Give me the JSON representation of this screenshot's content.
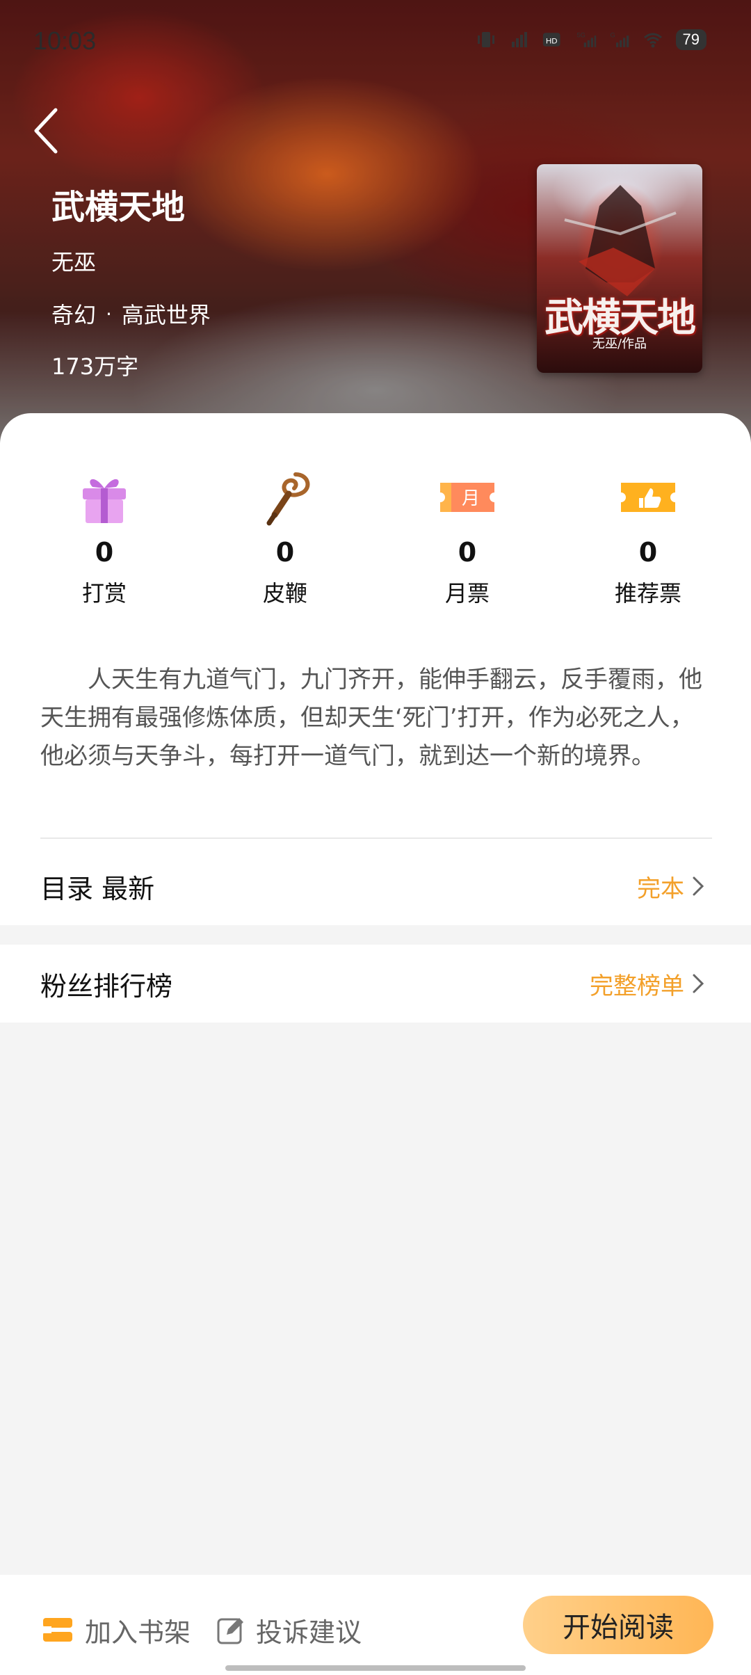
{
  "status_bar": {
    "time": "10:03",
    "battery": "79",
    "icons": [
      "vibrate-icon",
      "signal-hd-icon",
      "hd-icon",
      "5g-signal-icon",
      "g-signal-icon",
      "wifi-icon"
    ]
  },
  "book": {
    "title": "武横天地",
    "author": "无巫",
    "genre_main": "奇幻",
    "genre_sub": "高武世界",
    "genre_separator": "·",
    "word_count": "173万字",
    "cover_title": "武横天地",
    "cover_subtitle": "无巫/作品"
  },
  "stats": [
    {
      "icon": "gift-icon",
      "value": "0",
      "label": "打赏"
    },
    {
      "icon": "whip-icon",
      "value": "0",
      "label": "皮鞭"
    },
    {
      "icon": "monthly-ticket-icon",
      "value": "0",
      "label": "月票",
      "icon_text": "月"
    },
    {
      "icon": "recommend-ticket-icon",
      "value": "0",
      "label": "推荐票"
    }
  ],
  "synopsis": "人天生有九道气门，九门齐开，能伸手翻云，反手覆雨，他天生拥有最强修炼体质，但却天生‘死门’打开，作为必死之人，他必须与天争斗，每打开一道气门，就到达一个新的境界。",
  "catalog": {
    "label": "目录 最新",
    "status": "完本"
  },
  "fans": {
    "label": "粉丝排行榜",
    "link": "完整榜单"
  },
  "bottom": {
    "add_shelf": "加入书架",
    "feedback": "投诉建议",
    "start_reading": "开始阅读"
  },
  "colors": {
    "accent": "#f3a02a",
    "button_gradient_start": "#ffd08a",
    "button_gradient_end": "#ffb655"
  }
}
